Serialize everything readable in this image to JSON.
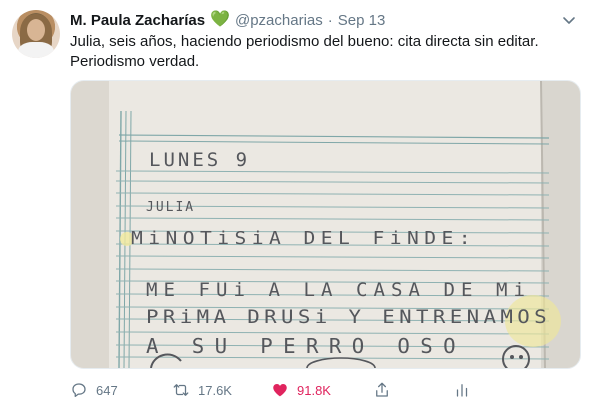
{
  "tweet": {
    "author_name": "M. Paula Zacharías",
    "author_emoji": "💚",
    "handle": "@pzacharias",
    "separator": "·",
    "date": "Sep 13",
    "text": "Julia, seis años, haciendo periodismo del bueno: cita directa sin editar. Periodismo verdad.",
    "media": {
      "handwritten_lines": [
        "LUNES 9",
        "JULIA",
        "MiNOTiSiA DEL FiNDE:",
        "ME FUi A LA CASA DE Mi",
        "PRiMA DRUSi Y ENTRENAMOS",
        "A SU PERRO OSO"
      ]
    },
    "actions": {
      "replies": "647",
      "retweets": "17.6K",
      "likes": "91.8K"
    }
  },
  "colors": {
    "text": "#14171a",
    "muted": "#657786",
    "like": "#e0245e",
    "paper": "#e9e6df",
    "rule": "#7fa7a8"
  },
  "icons": [
    "avatar",
    "green-heart-emoji",
    "chevron-down-icon",
    "reply-icon",
    "retweet-icon",
    "like-icon",
    "share-icon",
    "analytics-icon"
  ]
}
